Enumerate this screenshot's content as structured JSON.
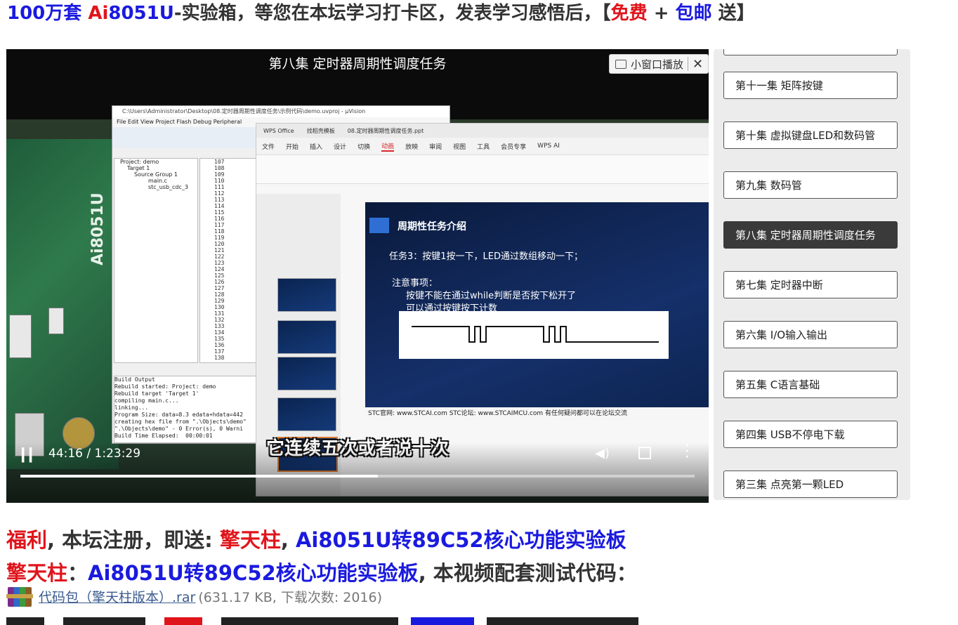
{
  "promo": {
    "part1": "100万套 ",
    "part2": "Ai",
    "part3": "8051U",
    "part4": "-实验箱，等您在本坛学习打卡区，发表学习感悟后，【",
    "part5": "免费",
    "part6": " + ",
    "part7": "包邮",
    "part8": " 送】"
  },
  "video": {
    "title": "第八集 定时器周期性调度任务",
    "mini_window_label": "小窗口播放",
    "subtitle": "它连续五次或者说十次",
    "time": "44:16 / 1:23:29",
    "progress_fraction": 0.53,
    "ide": {
      "title": "C:\\Users\\Administrator\\Desktop\\08.定时器周期性调度任务\\示例代码\\demo.uvproj - µVision",
      "menu": "File   Edit   View   Project   Flash   Debug   Peripheral",
      "project_tree": [
        "Project: demo",
        "Target 1",
        "Source Group 1",
        "main.c",
        "stc_usb_cdc_3"
      ],
      "line_numbers": "107\n108\n109\n110\n111\n112\n113\n114\n115\n116\n117\n118\n119\n120\n121\n122\n123\n124\n125\n126\n127\n128\n129\n130\n131\n132\n133\n134\n135\n136\n137\n138",
      "build_output": "Build Output\nRebuild started: Project: demo\nRebuild target 'Target 1'\ncompiling main.c...\nlinking...\nProgram Size: data=8.3 edata+hdata=442\ncreating hex file from \".\\Objects\\demo\"\n\".\\Objects\\demo\" - 0 Error(s), 0 Warni\nBuild Time Elapsed:  00:00:01"
    },
    "wps": {
      "tabs": [
        "WPS Office",
        "找稻壳模板",
        "08.定时器周期性调度任务.ppt"
      ],
      "ribbon": [
        "文件",
        "开始",
        "插入",
        "设计",
        "切换",
        "动画",
        "放映",
        "审阅",
        "视图",
        "工具",
        "会员专享",
        "WPS AI"
      ],
      "active_ribbon": "动画",
      "slide_title": "周期性任务介绍",
      "task_line": "任务3：按键1按一下，LED通过数组移动一下；",
      "note_heading": "注意事项：",
      "note_1": "按键不能在通过while判断是否按下松开了",
      "note_2": "可以通过按键按下计数",
      "footer": "STC官网: www.STCAI.com     STC论坛: www.STCAIMCU.com     有任何疑问都可以在论坛交流"
    }
  },
  "episodes": [
    {
      "label": "第十一集 矩阵按键",
      "active": false
    },
    {
      "label": "第十集 虚拟键盘LED和数码管",
      "active": false
    },
    {
      "label": "第九集 数码管",
      "active": false
    },
    {
      "label": "第八集 定时器周期性调度任务",
      "active": true
    },
    {
      "label": "第七集 定时器中断",
      "active": false
    },
    {
      "label": "第六集 I/O输入输出",
      "active": false
    },
    {
      "label": "第五集 C语言基础",
      "active": false
    },
    {
      "label": "第四集 USB不停电下载",
      "active": false
    },
    {
      "label": "第三集 点亮第一颗LED",
      "active": false
    }
  ],
  "benefit": {
    "w1": "福利",
    "w2": ", 本坛注册，即送: ",
    "w3": "擎天柱",
    "w4": ", ",
    "w5": "Ai8051U转89C52核心功能实验板"
  },
  "code_line": {
    "w1": "擎天柱",
    "w2": "：",
    "w3": "Ai8051U转89C52核心功能实验板",
    "w4": ", 本视频配套测试代码："
  },
  "attachment": {
    "link": "代码包（擎天柱版本）.rar",
    "meta": "(631.17 KB, 下载次数: 2016)"
  },
  "colors": {
    "blue": "#1a1adf",
    "red": "#e0151c",
    "active_episode_bg": "#3a3a3a"
  }
}
